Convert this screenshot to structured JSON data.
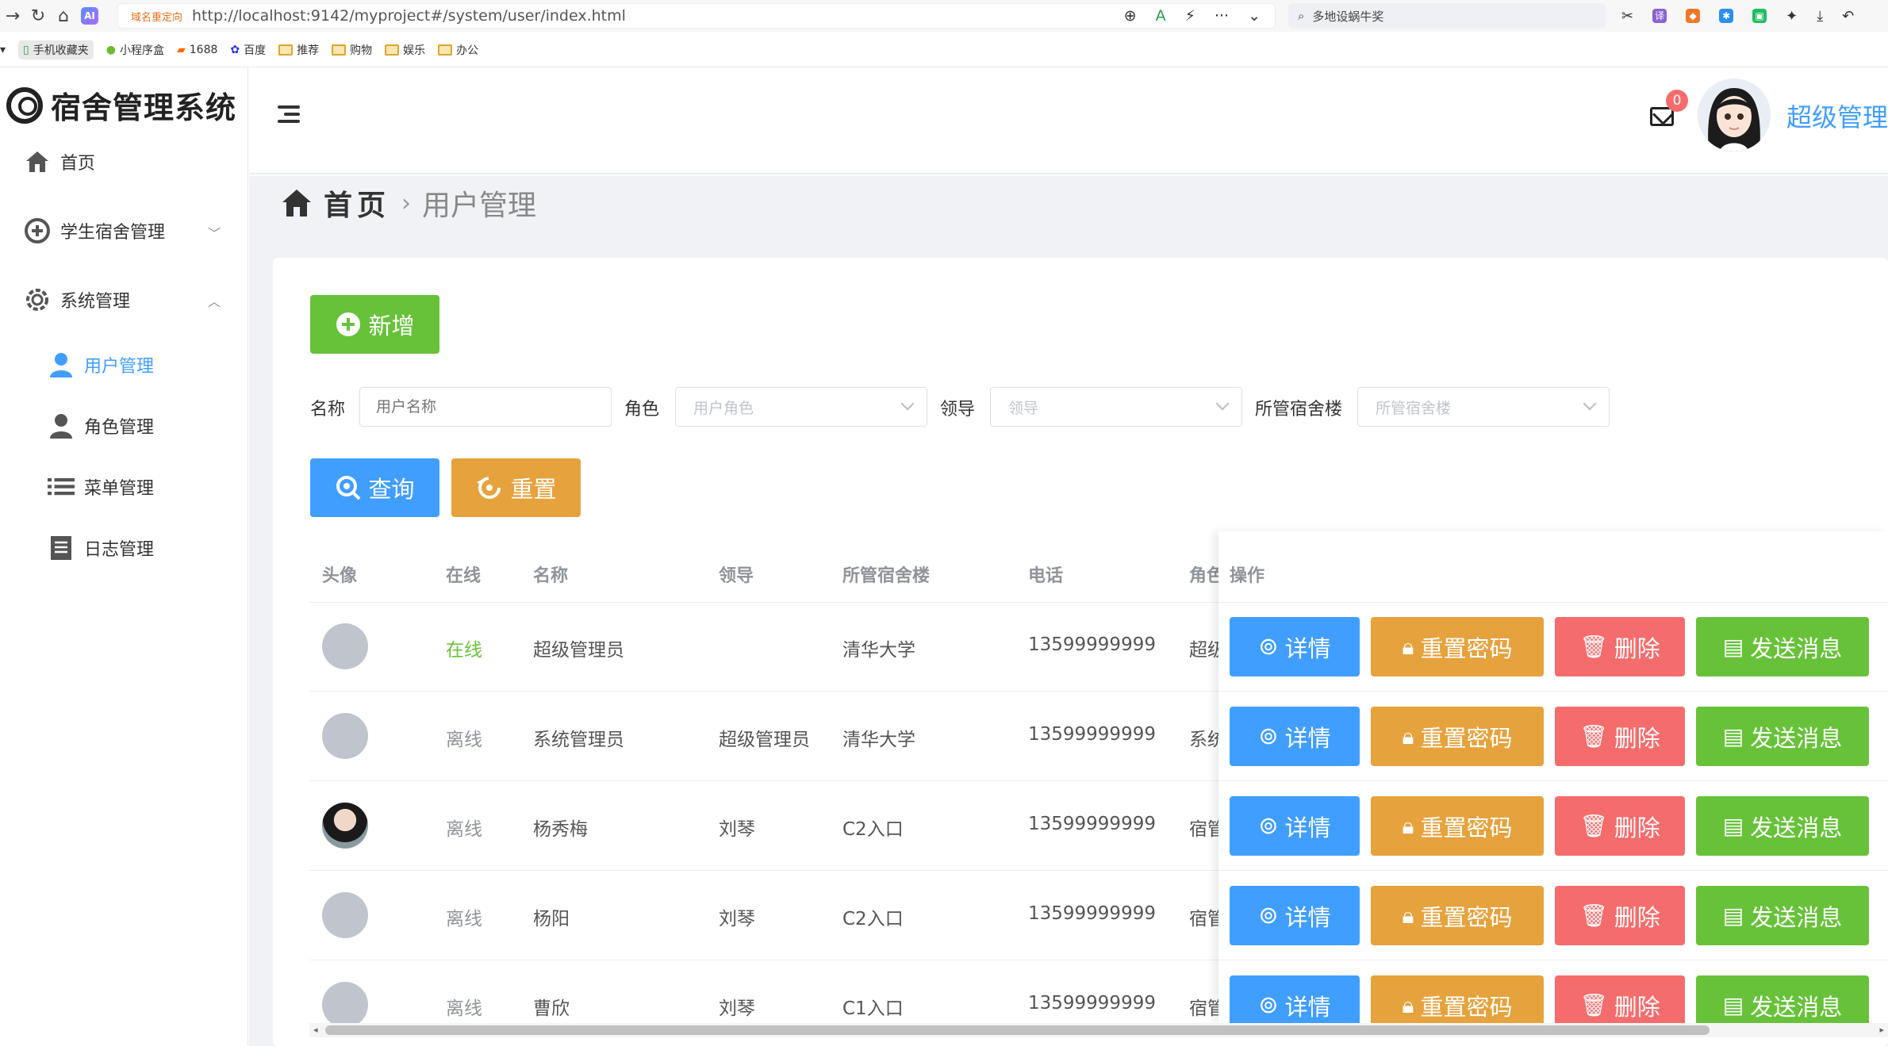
{
  "browser": {
    "redirect_tag": "域名重定向",
    "url": "http://localhost:9142/myproject#/system/user/index.html",
    "search_text": "多地设蜗牛奖",
    "bookmarks": [
      "手机收藏夹",
      "小程序盒",
      "1688",
      "百度",
      "推荐",
      "购物",
      "娱乐",
      "办公"
    ]
  },
  "sidebar": {
    "logo_text": "宿舍管理系统",
    "items": [
      {
        "label": "首页"
      },
      {
        "label": "学生宿舍管理"
      },
      {
        "label": "系统管理"
      },
      {
        "label": "用户管理"
      },
      {
        "label": "角色管理"
      },
      {
        "label": "菜单管理"
      },
      {
        "label": "日志管理"
      }
    ]
  },
  "header": {
    "badge_count": "0",
    "user_name": "超级管理"
  },
  "breadcrumb": {
    "home": "首页",
    "current": "用户管理"
  },
  "toolbar": {
    "add_label": "新增",
    "query_label": "查询",
    "reset_label": "重置"
  },
  "filters": {
    "name_label": "名称",
    "name_placeholder": "用户名称",
    "role_label": "角色",
    "role_placeholder": "用户角色",
    "leader_label": "领导",
    "leader_placeholder": "领导",
    "building_label": "所管宿舍楼",
    "building_placeholder": "所管宿舍楼"
  },
  "table": {
    "headers": {
      "avatar": "头像",
      "online": "在线",
      "name": "名称",
      "leader": "领导",
      "building": "所管宿舍楼",
      "phone": "电话",
      "role": "角色",
      "ops": "操作"
    },
    "rows": [
      {
        "online": "在线",
        "name": "超级管理员",
        "leader": "",
        "building": "清华大学",
        "phone": "13599999999",
        "role": "超级"
      },
      {
        "online": "离线",
        "name": "系统管理员",
        "leader": "超级管理员",
        "building": "清华大学",
        "phone": "13599999999",
        "role": "系统"
      },
      {
        "online": "离线",
        "name": "杨秀梅",
        "leader": "刘琴",
        "building": "C2入口",
        "phone": "13599999999",
        "role": "宿管"
      },
      {
        "online": "离线",
        "name": "杨阳",
        "leader": "刘琴",
        "building": "C2入口",
        "phone": "13599999999",
        "role": "宿管"
      },
      {
        "online": "离线",
        "name": "曹欣",
        "leader": "刘琴",
        "building": "C1入口",
        "phone": "13599999999",
        "role": "宿管"
      }
    ],
    "actions": {
      "detail": "详情",
      "reset_pwd": "重置密码",
      "delete": "删除",
      "send_msg": "发送消息"
    }
  },
  "colors": {
    "primary": "#409eff",
    "success": "#67c23a",
    "warning": "#e6a23c",
    "danger": "#f56c6c"
  }
}
